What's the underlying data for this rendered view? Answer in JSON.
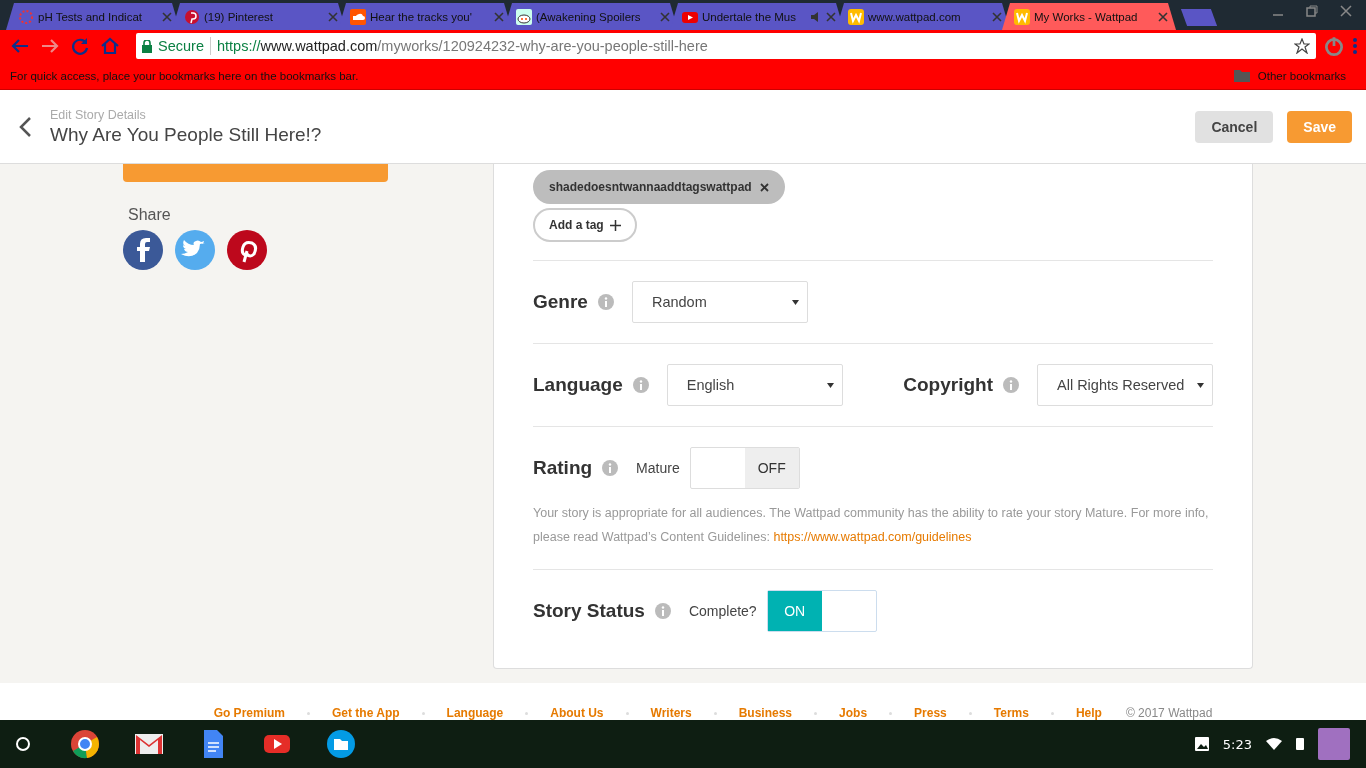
{
  "browser": {
    "tabs": [
      {
        "title": "pH Tests and Indicat",
        "selected": false
      },
      {
        "title": "(19) Pinterest",
        "selected": false
      },
      {
        "title": "Hear the tracks you'",
        "selected": false
      },
      {
        "title": "(Awakening Spoilers",
        "selected": false
      },
      {
        "title": "Undertale the Mus",
        "selected": false,
        "audio": true
      },
      {
        "title": "www.wattpad.com",
        "selected": false
      },
      {
        "title": "My Works - Wattpad",
        "selected": true
      }
    ],
    "secure_label": "Secure",
    "url_scheme": "https://",
    "url_host": "www.wattpad.com",
    "url_path": "/myworks/120924232-why-are-you-people-still-here",
    "bookmarks_hint": "For quick access, place your bookmarks here on the bookmarks bar.",
    "other_bookmarks": "Other bookmarks"
  },
  "header": {
    "subtitle": "Edit Story Details",
    "title": "Why Are You People Still Here!?",
    "buttons": [
      {
        "label": "Cancel",
        "kind": "secondary"
      },
      {
        "label": "Save",
        "kind": "primary"
      }
    ]
  },
  "sidebar": {
    "share_label": "Share",
    "share": [
      {
        "kind": "facebook"
      },
      {
        "kind": "twitter"
      },
      {
        "kind": "pinterest"
      }
    ]
  },
  "form": {
    "tags": [
      {
        "label": "shadedoesntwannaaddtagswattpad"
      }
    ],
    "add_tag": "Add a tag",
    "genre": {
      "label": "Genre",
      "value": "Random"
    },
    "language": {
      "label": "Language",
      "value": "English"
    },
    "copyright": {
      "label": "Copyright",
      "value": "All Rights Reserved"
    },
    "rating": {
      "label": "Rating",
      "switch_label": "Mature",
      "on": false,
      "off_text": "OFF",
      "note": "Your story is appropriate for all audiences. The Wattpad community has the ability to rate your story Mature. For more info, please read Wattpad’s Content Guidelines:",
      "link": "https://www.wattpad.com/guidelines"
    },
    "status": {
      "label": "Story Status",
      "switch_label": "Complete?",
      "on": true,
      "on_text": "ON"
    }
  },
  "footer": {
    "links": [
      "Go Premium",
      "Get the App",
      "Language",
      "About Us",
      "Writers",
      "Business",
      "Jobs",
      "Press",
      "Terms",
      "Help"
    ],
    "copyright": "© 2017 Wattpad"
  },
  "shelf": {
    "time": "5:23"
  }
}
